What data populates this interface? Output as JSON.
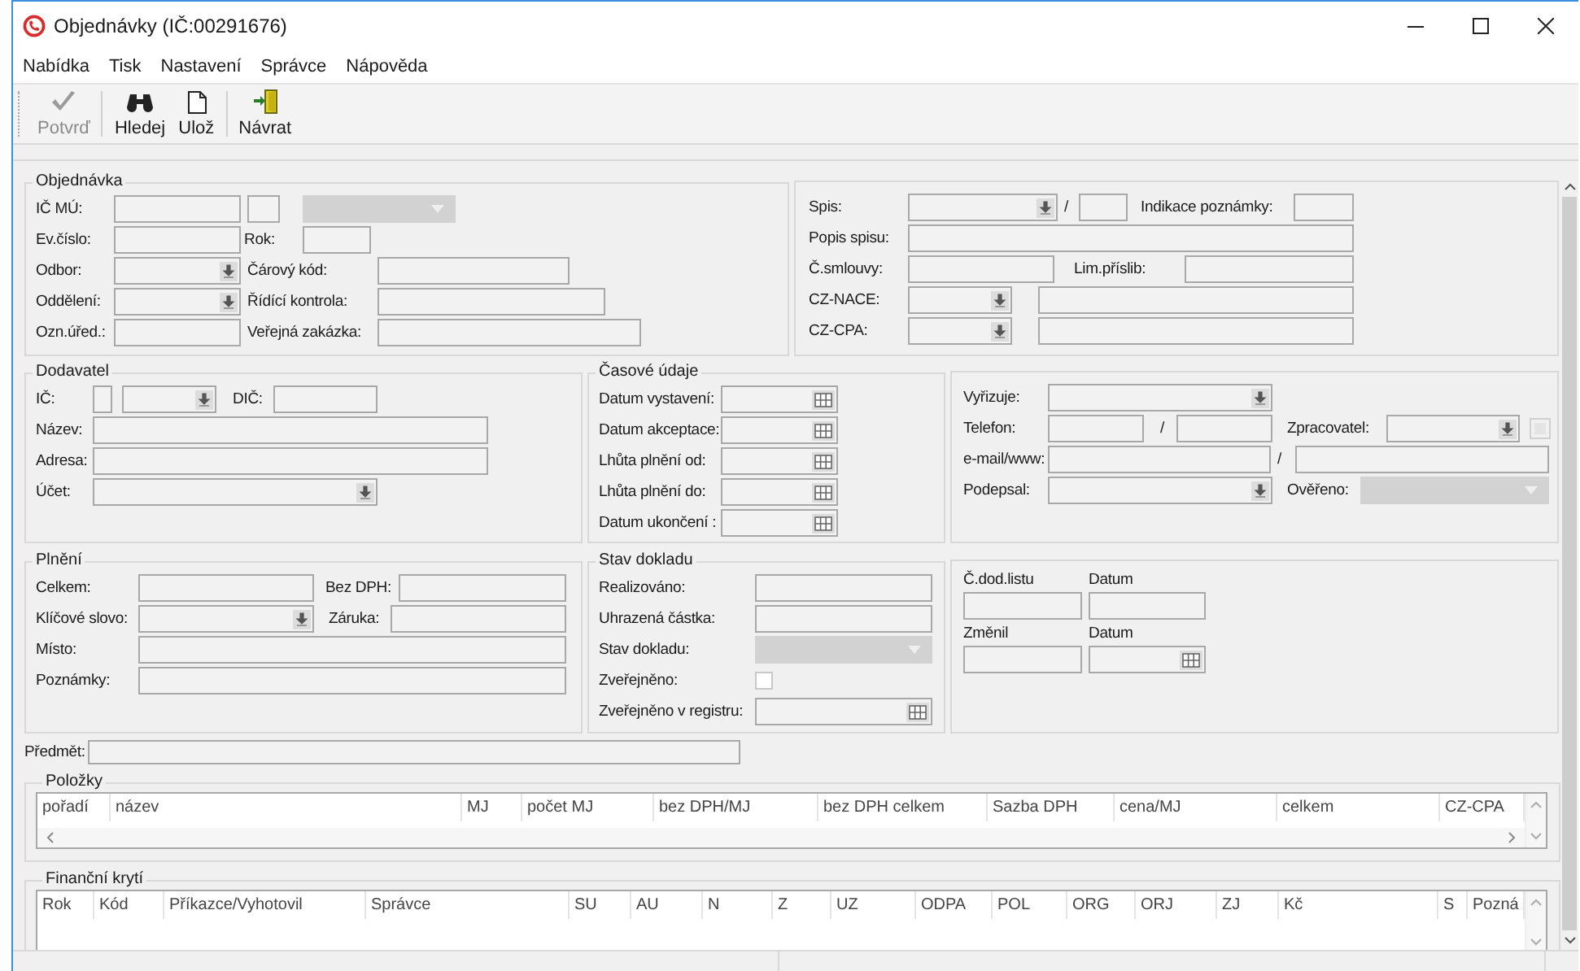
{
  "window": {
    "title": "Objednávky (IČ:00291676)"
  },
  "menu": [
    "Nabídka",
    "Tisk",
    "Nastavení",
    "Správce",
    "Nápověda"
  ],
  "toolbar": [
    [
      {
        "label": "Potvrď",
        "kind": "check",
        "disabled": true
      }
    ],
    [
      {
        "label": "Hledej",
        "kind": "binoculars",
        "disabled": false
      },
      {
        "label": "Ulož",
        "kind": "page",
        "disabled": false
      }
    ],
    [
      {
        "label": "Návrat",
        "kind": "exit",
        "disabled": false
      }
    ]
  ],
  "sections": [
    {
      "title": "Objednávka",
      "rows": [
        [
          {
            "kind": "label",
            "text": "IČ MÚ:"
          },
          {
            "kind": "field"
          },
          {
            "kind": "field"
          },
          {
            "kind": "select"
          }
        ],
        [
          {
            "kind": "label",
            "text": "Ev.číslo:"
          },
          {
            "kind": "field"
          },
          {
            "kind": "label",
            "text": "Rok:"
          },
          {
            "kind": "field"
          }
        ],
        [
          {
            "kind": "label",
            "text": "Odbor:"
          },
          {
            "kind": "combo"
          },
          {
            "kind": "label",
            "text": "Čárový kód:"
          },
          {
            "kind": "field"
          }
        ],
        [
          {
            "kind": "label",
            "text": "Oddělení:"
          },
          {
            "kind": "combo"
          },
          {
            "kind": "label",
            "text": "Řídící kontrola:"
          },
          {
            "kind": "field"
          }
        ],
        [
          {
            "kind": "label",
            "text": "Ozn.úřed.:"
          },
          {
            "kind": "field"
          },
          {
            "kind": "label",
            "text": "Veřejná zakázka:"
          },
          {
            "kind": "field"
          }
        ]
      ]
    },
    {
      "rows": [
        [
          {
            "kind": "label",
            "text": "Spis:"
          },
          {
            "kind": "combo"
          },
          {
            "kind": "label",
            "text": "/"
          },
          {
            "kind": "field"
          },
          {
            "kind": "label",
            "text": "Indikace poznámky:"
          },
          {
            "kind": "field"
          }
        ],
        [
          {
            "kind": "label",
            "text": "Popis spisu:"
          },
          {
            "kind": "field"
          }
        ],
        [
          {
            "kind": "label",
            "text": "Č.smlouvy:"
          },
          {
            "kind": "field"
          },
          {
            "kind": "label",
            "text": "Lim.příslib:"
          },
          {
            "kind": "field"
          }
        ],
        [
          {
            "kind": "label",
            "text": "CZ-NACE:"
          },
          {
            "kind": "combo"
          },
          {
            "kind": "field"
          }
        ],
        [
          {
            "kind": "label",
            "text": "CZ-CPA:"
          },
          {
            "kind": "combo"
          },
          {
            "kind": "field"
          }
        ]
      ]
    },
    {
      "title": "Dodavatel",
      "rows": [
        [
          {
            "kind": "label",
            "text": "IČ:"
          },
          {
            "kind": "field"
          },
          {
            "kind": "combo"
          },
          {
            "kind": "label",
            "text": "DIČ:"
          },
          {
            "kind": "field"
          }
        ],
        [
          {
            "kind": "label",
            "text": "Název:"
          },
          {
            "kind": "field"
          }
        ],
        [
          {
            "kind": "label",
            "text": "Adresa:"
          },
          {
            "kind": "field"
          }
        ],
        [
          {
            "kind": "label",
            "text": "Účet:"
          },
          {
            "kind": "combo"
          }
        ]
      ]
    },
    {
      "title": "Časové údaje",
      "rows": [
        [
          {
            "kind": "label",
            "text": "Datum vystavení:"
          },
          {
            "kind": "date"
          }
        ],
        [
          {
            "kind": "label",
            "text": "Datum akceptace:"
          },
          {
            "kind": "date"
          }
        ],
        [
          {
            "kind": "label",
            "text": "Lhůta plnění od:"
          },
          {
            "kind": "date"
          }
        ],
        [
          {
            "kind": "label",
            "text": "Lhůta plnění do:"
          },
          {
            "kind": "date"
          }
        ],
        [
          {
            "kind": "label",
            "text": "Datum ukončení :"
          },
          {
            "kind": "date"
          }
        ]
      ]
    },
    {
      "rows": [
        [
          {
            "kind": "label",
            "text": "Vyřizuje:"
          },
          {
            "kind": "combo"
          }
        ],
        [
          {
            "kind": "label",
            "text": "Telefon:"
          },
          {
            "kind": "field"
          },
          {
            "kind": "label",
            "text": "/"
          },
          {
            "kind": "field"
          },
          {
            "kind": "label",
            "text": "Zpracovatel:"
          },
          {
            "kind": "combo"
          },
          {
            "kind": "checkbox",
            "checked": false,
            "disabled": true
          }
        ],
        [
          {
            "kind": "label",
            "text": "e-mail/www:"
          },
          {
            "kind": "field"
          },
          {
            "kind": "label",
            "text": "/"
          },
          {
            "kind": "field"
          }
        ],
        [
          {
            "kind": "label",
            "text": "Podepsal:"
          },
          {
            "kind": "combo"
          },
          {
            "kind": "gap"
          },
          {
            "kind": "gap"
          },
          {
            "kind": "label",
            "text": "Ověřeno:"
          },
          {
            "kind": "select"
          }
        ]
      ]
    },
    {
      "title": "Plnění",
      "rows": [
        [
          {
            "kind": "label",
            "text": "Celkem:"
          },
          {
            "kind": "field"
          },
          {
            "kind": "label",
            "text": "Bez DPH:"
          },
          {
            "kind": "field"
          }
        ],
        [
          {
            "kind": "label",
            "text": "Klíčové slovo:"
          },
          {
            "kind": "combo"
          },
          {
            "kind": "label",
            "text": "Záruka:"
          },
          {
            "kind": "field"
          }
        ],
        [
          {
            "kind": "label",
            "text": "Místo:"
          },
          {
            "kind": "field"
          }
        ],
        [
          {
            "kind": "label",
            "text": "Poznámky:"
          },
          {
            "kind": "field"
          }
        ]
      ]
    },
    {
      "title": "Stav dokladu",
      "rows": [
        [
          {
            "kind": "label",
            "text": "Realizováno:"
          },
          {
            "kind": "field"
          }
        ],
        [
          {
            "kind": "label",
            "text": "Uhrazená částka:"
          },
          {
            "kind": "field"
          }
        ],
        [
          {
            "kind": "label",
            "text": "Stav dokladu:"
          },
          {
            "kind": "select"
          }
        ],
        [
          {
            "kind": "label",
            "text": "Zveřejněno:"
          },
          {
            "kind": "checkbox",
            "checked": false,
            "disabled": false
          }
        ],
        [
          {
            "kind": "label",
            "text": "Zveřejněno v registru:"
          },
          {
            "kind": "date"
          }
        ]
      ]
    },
    {
      "rows": [
        [
          {
            "kind": "label",
            "text": "Č.dod.listu"
          },
          {
            "kind": "label",
            "text": "Datum"
          }
        ],
        [
          {
            "kind": "field"
          },
          {
            "kind": "field"
          }
        ],
        [
          {
            "kind": "label",
            "text": "Změnil"
          },
          {
            "kind": "label",
            "text": "Datum"
          }
        ],
        [
          {
            "kind": "field"
          },
          {
            "kind": "date"
          }
        ]
      ]
    }
  ],
  "subject": {
    "label": "Předmět:"
  },
  "items_table": {
    "title": "Položky",
    "columns": [
      "pořadí",
      "název",
      "MJ",
      "počet MJ",
      "bez DPH/MJ",
      "bez DPH celkem",
      "Sazba DPH",
      "cena/MJ",
      "celkem",
      "CZ-CPA"
    ]
  },
  "funding_table": {
    "title": "Finanční krytí",
    "columns": [
      "Rok",
      "Kód",
      "Příkazce/Vyhotovil",
      "Správce",
      "SU",
      "AU",
      "N",
      "Z",
      "UZ",
      "ODPA",
      "POL",
      "ORG",
      "ORJ",
      "ZJ",
      "Kč",
      "S",
      "Pozná"
    ]
  }
}
